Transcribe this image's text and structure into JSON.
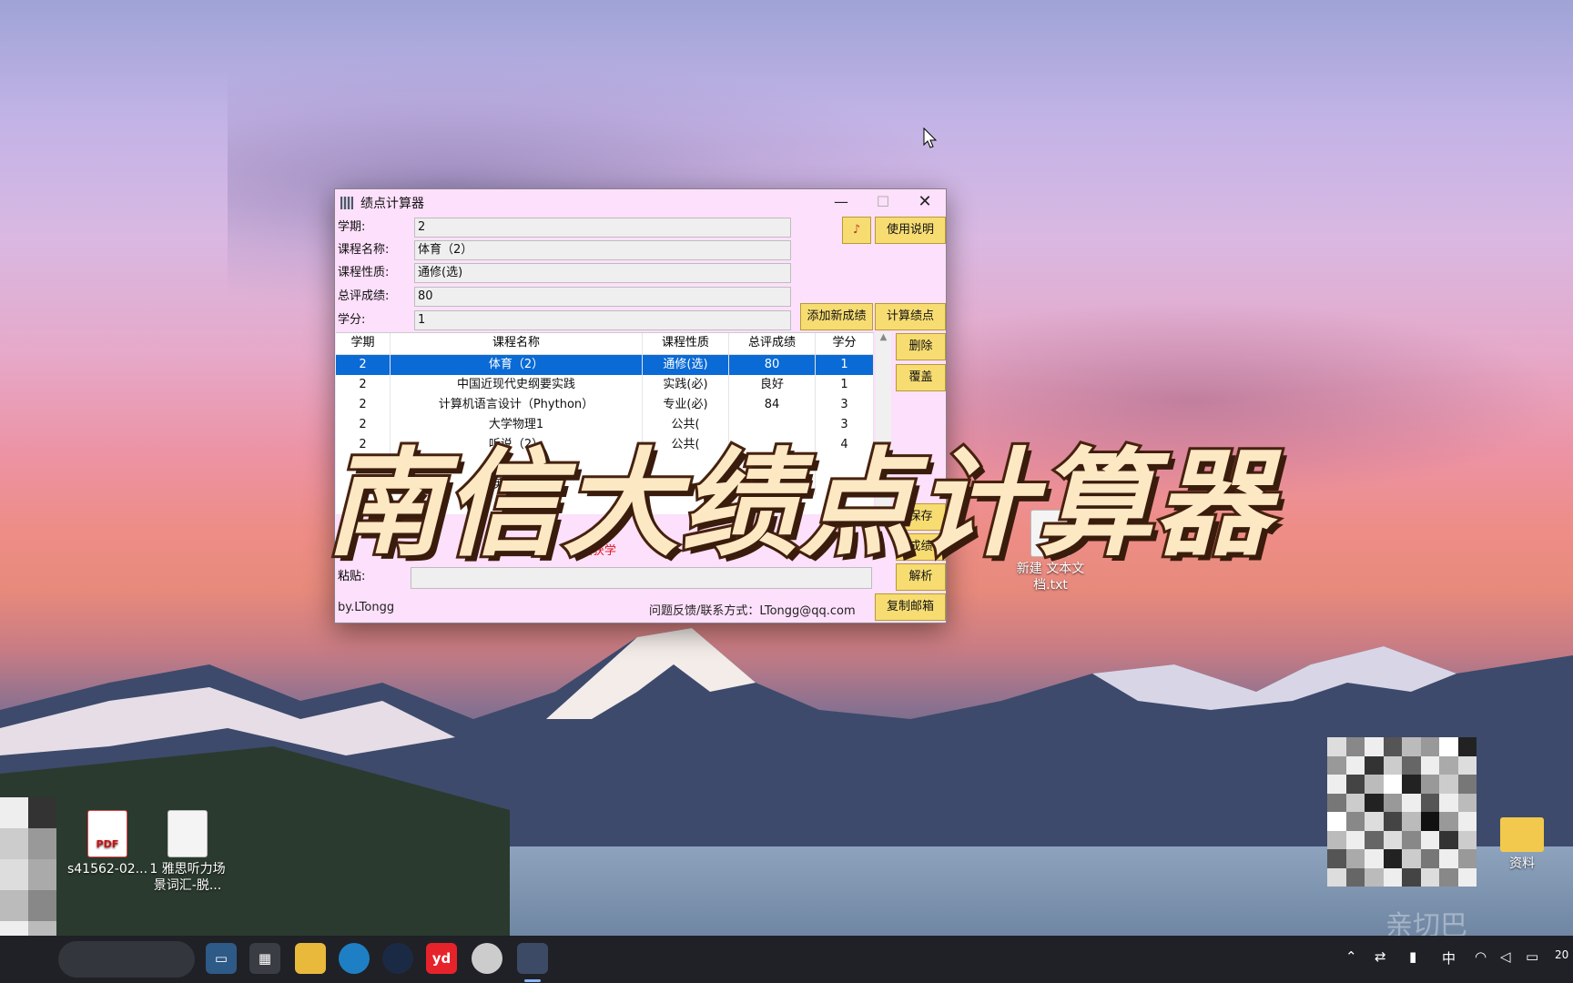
{
  "window": {
    "title": "绩点计算器",
    "controls": {
      "minimize": "—",
      "maximize": "☐",
      "close": "✕"
    }
  },
  "form": {
    "semester_label": "学期:",
    "semester_value": "2",
    "course_label": "课程名称:",
    "course_value": "体育（2）",
    "nature_label": "课程性质:",
    "nature_value": "通修(选)",
    "score_label": "总评成绩:",
    "score_value": "80",
    "credit_label": "学分:",
    "credit_value": "1"
  },
  "buttons": {
    "help": "使用说明",
    "add": "添加新成绩",
    "calc": "计算绩点",
    "delete": "删除",
    "overwrite": "覆盖",
    "save": "保存",
    "grade": "成绩",
    "parse": "解析",
    "copy_email": "复制邮箱"
  },
  "table": {
    "headers": [
      "学期",
      "课程名称",
      "课程性质",
      "总评成绩",
      "学分"
    ],
    "rows": [
      [
        "2",
        "体育（2）",
        "通修(选)",
        "80",
        "1"
      ],
      [
        "2",
        "中国近现代史纲要实践",
        "实践(必)",
        "良好",
        "1"
      ],
      [
        "2",
        "计算机语言设计（Phython）",
        "专业(必)",
        "84",
        "3"
      ],
      [
        "2",
        "大学物理1",
        "公共(",
        "",
        "3"
      ],
      [
        "2",
        "听说（2）",
        "公共(",
        "",
        "4"
      ],
      [
        "",
        "",
        "",
        "",
        ""
      ],
      [
        "",
        "英语实践",
        "",
        "",
        ""
      ]
    ]
  },
  "summary": "共获学",
  "paste": {
    "label": "粘贴:",
    "value": ""
  },
  "footer": {
    "author": "by.LTongg",
    "contact": "问题反馈/联系方式：LTongg@qq.com"
  },
  "overlay_title": "南信大绩点计算器",
  "desktop": {
    "icons": [
      {
        "label": "s41562-02...",
        "type": "pdf",
        "tag": "PDF"
      },
      {
        "label": "1 雅思听力场景词汇-脱...",
        "type": "txt"
      },
      {
        "label": "新建 文本文档.txt",
        "type": "txt"
      },
      {
        "label": "资料",
        "type": "folder"
      }
    ]
  },
  "taskbar": {
    "apps": [
      "file-explorer",
      "edge",
      "steam",
      "youdao",
      "game",
      "calculator-app"
    ],
    "youdao_label": "yd",
    "tray_input": "中",
    "tray_clock_partial": "20"
  },
  "watermark": "亲切巴"
}
